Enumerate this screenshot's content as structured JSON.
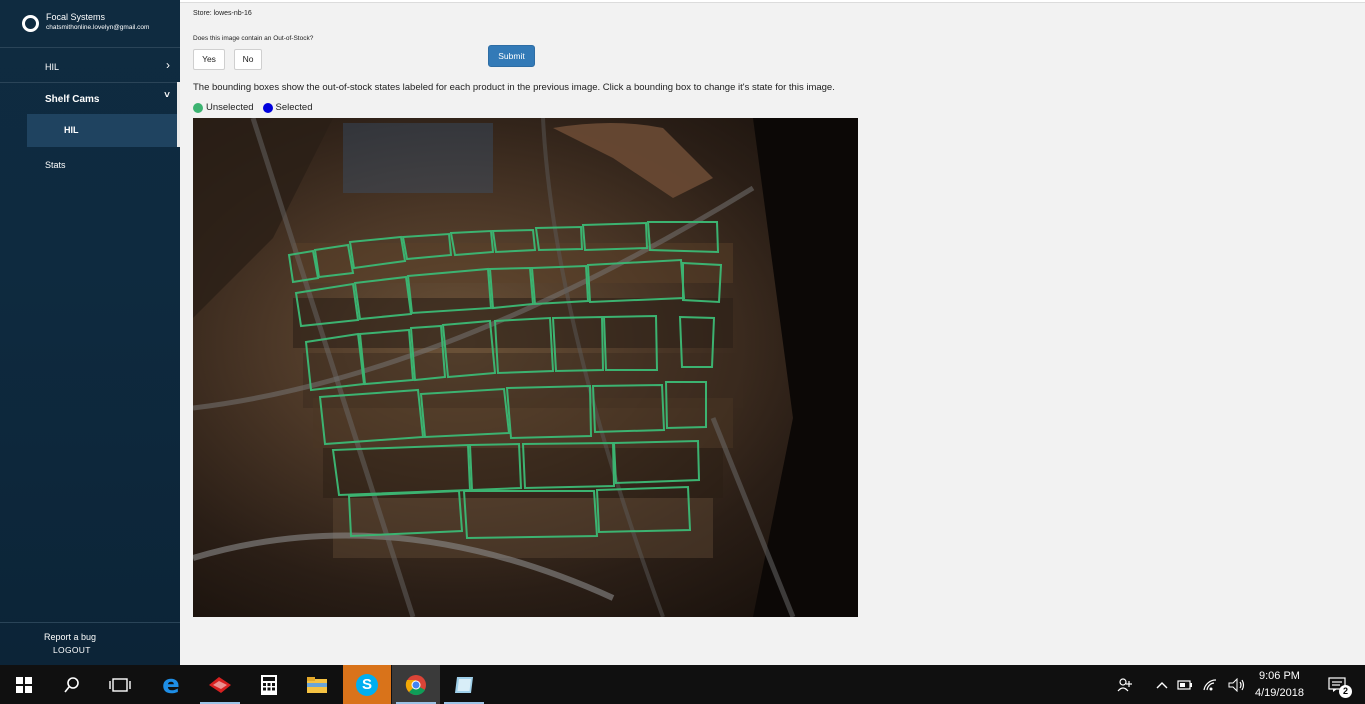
{
  "brand": {
    "name": "Focal Systems",
    "email": "chatsmithonline.lovelyn@gmail.com"
  },
  "sidebar": {
    "items": [
      {
        "label": "HIL",
        "chevron": "›"
      },
      {
        "label": "Shelf Cams",
        "chevron": "˅"
      },
      {
        "label": "HIL"
      },
      {
        "label": "Stats"
      }
    ],
    "report_bug": "Report a bug",
    "logout": "LOGOUT"
  },
  "main": {
    "store": "Store: lowes-nb-16",
    "question": "Does this image contain an Out-of-Stock?",
    "yes_label": "Yes",
    "no_label": "No",
    "submit_label": "Submit",
    "instructions": "The bounding boxes show the out-of-stock states labeled for each product in the previous image. Click a bounding box to change it's state for this image.",
    "legend": {
      "unselected": "Unselected",
      "selected": "Selected"
    }
  },
  "colors": {
    "unselected": "#3cb371",
    "selected": "#0000dd",
    "submit": "#337ab7",
    "sidebar": "#0f2b40"
  },
  "taskbar": {
    "apps": [
      "windows-start-icon",
      "search-icon",
      "task-view-icon",
      "edge-icon",
      "app-red-icon",
      "calculator-icon",
      "file-explorer-icon",
      "skype-icon",
      "chrome-icon",
      "notepad-icon"
    ],
    "time": "9:06 PM",
    "date": "4/19/2018",
    "notifications": "2"
  }
}
